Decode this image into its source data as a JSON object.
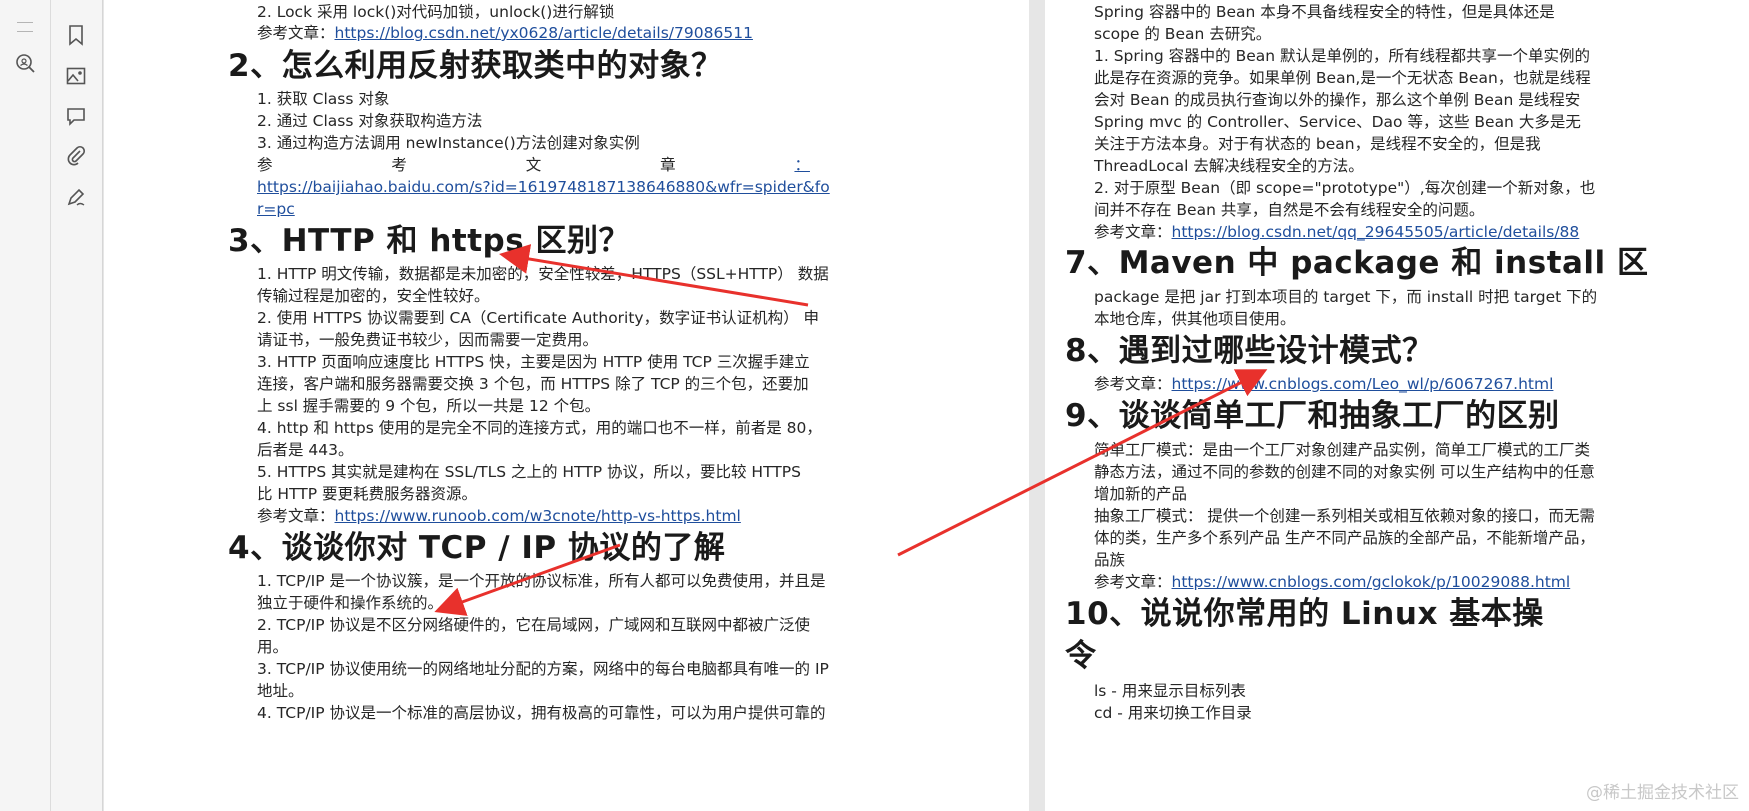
{
  "toolbar_icons": [
    "zoom-search-icon",
    "bookmark-icon",
    "image-icon",
    "comment-icon",
    "attachment-icon",
    "signature-pen-icon"
  ],
  "left_page": {
    "top1": "2. Lock 采用 lock()对代码加锁，unlock()进行解锁",
    "top2_label": "参考文章：",
    "top2_link": "https://blog.csdn.net/yx0628/article/details/79086511",
    "q2": {
      "heading": "2、怎么利用反射获取类中的对象？",
      "l1": "1. 获取 Class 对象",
      "l2": "2. 通过 Class 对象获取构造方法",
      "l3": "3. 通过构造方法调用 newInstance()方法创建对象实例",
      "ref_chars": [
        "参",
        "考",
        "文",
        "章",
        "："
      ],
      "ref_link_1": "https://baijiahao.baidu.com/s?id=1619748187138646880&wfr=spider&fo",
      "ref_link_2": "r=pc"
    },
    "q3": {
      "heading": "3、HTTP 和 https 区别？",
      "lines": [
        "1. HTTP 明文传输，数据都是未加密的，安全性较差，HTTPS（SSL+HTTP） 数据",
        "传输过程是加密的，安全性较好。",
        "2. 使用 HTTPS 协议需要到 CA（Certificate Authority，数字证书认证机构） 申",
        "请证书，一般免费证书较少，因而需要一定费用。",
        "3. HTTP 页面响应速度比 HTTPS 快，主要是因为 HTTP 使用 TCP 三次握手建立",
        "连接，客户端和服务器需要交换 3 个包，而 HTTPS 除了 TCP 的三个包，还要加",
        "上 ssl 握手需要的 9 个包，所以一共是 12 个包。",
        "4. http 和 https 使用的是完全不同的连接方式，用的端口也不一样，前者是 80，",
        "后者是 443。",
        "5. HTTPS 其实就是建构在 SSL/TLS 之上的 HTTP 协议，所以，要比较 HTTPS",
        "比 HTTP 要更耗费服务器资源。"
      ],
      "ref_label": "参考文章：",
      "ref_link": "https://www.runoob.com/w3cnote/http-vs-https.html"
    },
    "q4": {
      "heading": "4、谈谈你对 TCP / IP 协议的了解",
      "lines": [
        "1. TCP/IP 是一个协议簇，是一个开放的协议标准，所有人都可以免费使用，并且是",
        "独立于硬件和操作系统的。",
        "2. TCP/IP 协议是不区分网络硬件的，它在局域网，广域网和互联网中都被广泛使",
        "用。",
        "3. TCP/IP 协议使用统一的网络地址分配的方案，网络中的每台电脑都具有唯一的 IP",
        "地址。",
        "4. TCP/IP 协议是一个标准的高层协议，拥有极高的可靠性，可以为用户提供可靠的"
      ]
    }
  },
  "right_page": {
    "top_lines": [
      "Spring 容器中的 Bean 本身不具备线程安全的特性，但是具体还是",
      "scope 的 Bean 去研究。",
      "1. Spring 容器中的 Bean 默认是单例的，所有线程都共享一个单实例的",
      "此是存在资源的竞争。如果单例 Bean,是一个无状态 Bean，也就是线程",
      "会对 Bean 的成员执行查询以外的操作，那么这个单例 Bean 是线程安",
      "Spring mvc 的 Controller、Service、Dao 等，这些 Bean 大多是无",
      "关注于方法本身。对于有状态的 bean，是线程不安全的，但是我",
      "ThreadLocal 去解决线程安全的方法。",
      "2. 对于原型 Bean（即 scope=\"prototype\"）,每次创建一个新对象，也",
      "间并不存在 Bean 共享，自然是不会有线程安全的问题。"
    ],
    "top_ref_label": "参考文章：",
    "top_ref_link": "https://blog.csdn.net/qq_29645505/article/details/88",
    "q7": {
      "heading": "7、Maven 中 package 和 install 区",
      "lines": [
        "package 是把 jar 打到本项目的 target 下，而 install 时把 target 下的",
        "本地仓库，供其他项目使用。"
      ]
    },
    "q8": {
      "heading": "8、遇到过哪些设计模式？",
      "ref_label": "参考文章：",
      "ref_link": "https://www.cnblogs.com/Leo_wl/p/6067267.html"
    },
    "q9": {
      "heading": "9、谈谈简单工厂和抽象工厂的区别",
      "lines": [
        "简单工厂模式：是由一个工厂对象创建产品实例，简单工厂模式的工厂类",
        "静态方法，通过不同的参数的创建不同的对象实例  可以生产结构中的任意",
        "增加新的产品",
        "抽象工厂模式：  提供一个创建一系列相关或相互依赖对象的接口，而无需",
        "体的类，生产多个系列产品  生产不同产品族的全部产品，不能新增产品，",
        "品族"
      ],
      "ref_label": "参考文章：",
      "ref_link": "https://www.cnblogs.com/gclokok/p/10029088.html"
    },
    "q10": {
      "heading_1": "10、说说你常用的 Linux 基本操",
      "heading_2": "令",
      "lines": [
        "ls - 用来显示目标列表",
        "cd - 用来切换工作目录"
      ]
    }
  },
  "watermark": "@稀土掘金技术社区",
  "colors": {
    "link": "#1f4e9c",
    "arrow": "#e8312c",
    "text": "#262626",
    "panel": "#f5f5f5"
  }
}
